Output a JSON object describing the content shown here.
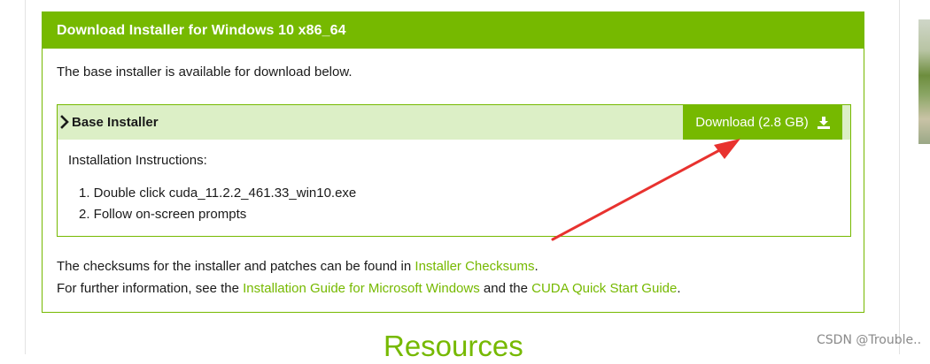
{
  "panel": {
    "title": "Download Installer for Windows 10 x86_64",
    "intro": "The base installer is available for download below."
  },
  "installer": {
    "title": "Base Installer",
    "download_label": "Download (2.8 GB)",
    "instructions_title": "Installation Instructions:",
    "steps": [
      "1. Double click cuda_11.2.2_461.33_win10.exe",
      "2. Follow on-screen prompts"
    ]
  },
  "footer": {
    "checksum_prefix": "The checksums for the installer and patches can be found in ",
    "checksum_link": "Installer Checksums",
    "checksum_suffix": ".",
    "info_prefix": "For further information, see the ",
    "guide_link": "Installation Guide for Microsoft Windows",
    "info_middle": " and the ",
    "quickstart_link": "CUDA Quick Start Guide",
    "info_suffix": "."
  },
  "resources_heading": "Resources",
  "watermark": "CSDN @Trouble..",
  "colors": {
    "accent": "#76b900",
    "header_bg": "#dcefc6",
    "annotation_arrow": "#e8322f"
  },
  "icons": {
    "chevron": "chevron-right-icon",
    "download": "download-icon"
  }
}
